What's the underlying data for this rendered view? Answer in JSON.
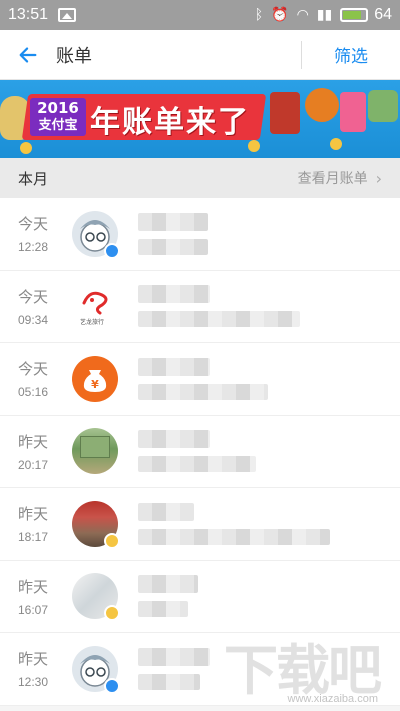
{
  "status_bar": {
    "time": "13:51",
    "battery_level": "64",
    "icons": [
      "image-icon",
      "bluetooth-icon",
      "alarm-icon",
      "wifi-icon",
      "signal-icon",
      "battery-icon"
    ]
  },
  "header": {
    "title": "账单",
    "filter_label": "筛选"
  },
  "banner": {
    "year": "2016",
    "app": "支付宝",
    "slogan": "年账单来了"
  },
  "section": {
    "month": "本月",
    "view_link": "查看月账单",
    "chevron": "›"
  },
  "transactions": [
    {
      "day": "今天",
      "time": "12:28",
      "avatar": "cartoon-boy-avatar",
      "badge": "blue"
    },
    {
      "day": "今天",
      "time": "09:34",
      "avatar": "yilong-logo-avatar",
      "badge": ""
    },
    {
      "day": "今天",
      "time": "05:16",
      "avatar": "money-bag-avatar",
      "badge": ""
    },
    {
      "day": "昨天",
      "time": "20:17",
      "avatar": "building-photo-avatar",
      "badge": ""
    },
    {
      "day": "昨天",
      "time": "18:17",
      "avatar": "shop-photo-avatar",
      "badge": "gold"
    },
    {
      "day": "昨天",
      "time": "16:07",
      "avatar": "photo-avatar",
      "badge": "gold"
    },
    {
      "day": "昨天",
      "time": "12:30",
      "avatar": "cartoon-boy-avatar",
      "badge": "blue"
    }
  ],
  "yilong_logo_text": "艺龙旅行",
  "watermark": {
    "text": "下载吧",
    "site": "www.xiazaiba.com"
  },
  "colors": {
    "accent": "#1a8cf0",
    "status_bar": "#9e9e9e",
    "banner": "#1b8fd6",
    "orange": "#f06a1c"
  }
}
